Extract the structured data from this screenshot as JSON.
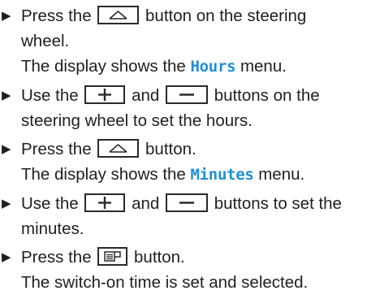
{
  "steps": [
    {
      "line1_pre": "Press the",
      "line1_post": "button on the steering",
      "line2": "wheel.",
      "result_pre": "The display shows the",
      "result_highlight": "Hours",
      "result_post": "menu."
    },
    {
      "line1_pre": "Use the",
      "line1_mid": "and",
      "line1_post": "buttons on the",
      "line2": "steering wheel to set the hours."
    },
    {
      "line1_pre": "Press the",
      "line1_post": "button.",
      "result_pre": "The display shows the",
      "result_highlight": "Minutes",
      "result_post": "menu."
    },
    {
      "line1_pre": "Use the",
      "line1_mid": "and",
      "line1_post": "buttons to set the",
      "line2": "minutes."
    },
    {
      "line1_pre": "Press the",
      "line1_post": "button.",
      "result": "The switch-on time is set and selected."
    }
  ],
  "bullet_glyph": "▶",
  "icons": {
    "home_button": "home-icon",
    "plus_button": "plus-icon",
    "minus_button": "minus-icon",
    "confirm_button": "confirm-icon"
  },
  "colors": {
    "highlight": "#1f8fd6",
    "text": "#1f1f1f"
  }
}
